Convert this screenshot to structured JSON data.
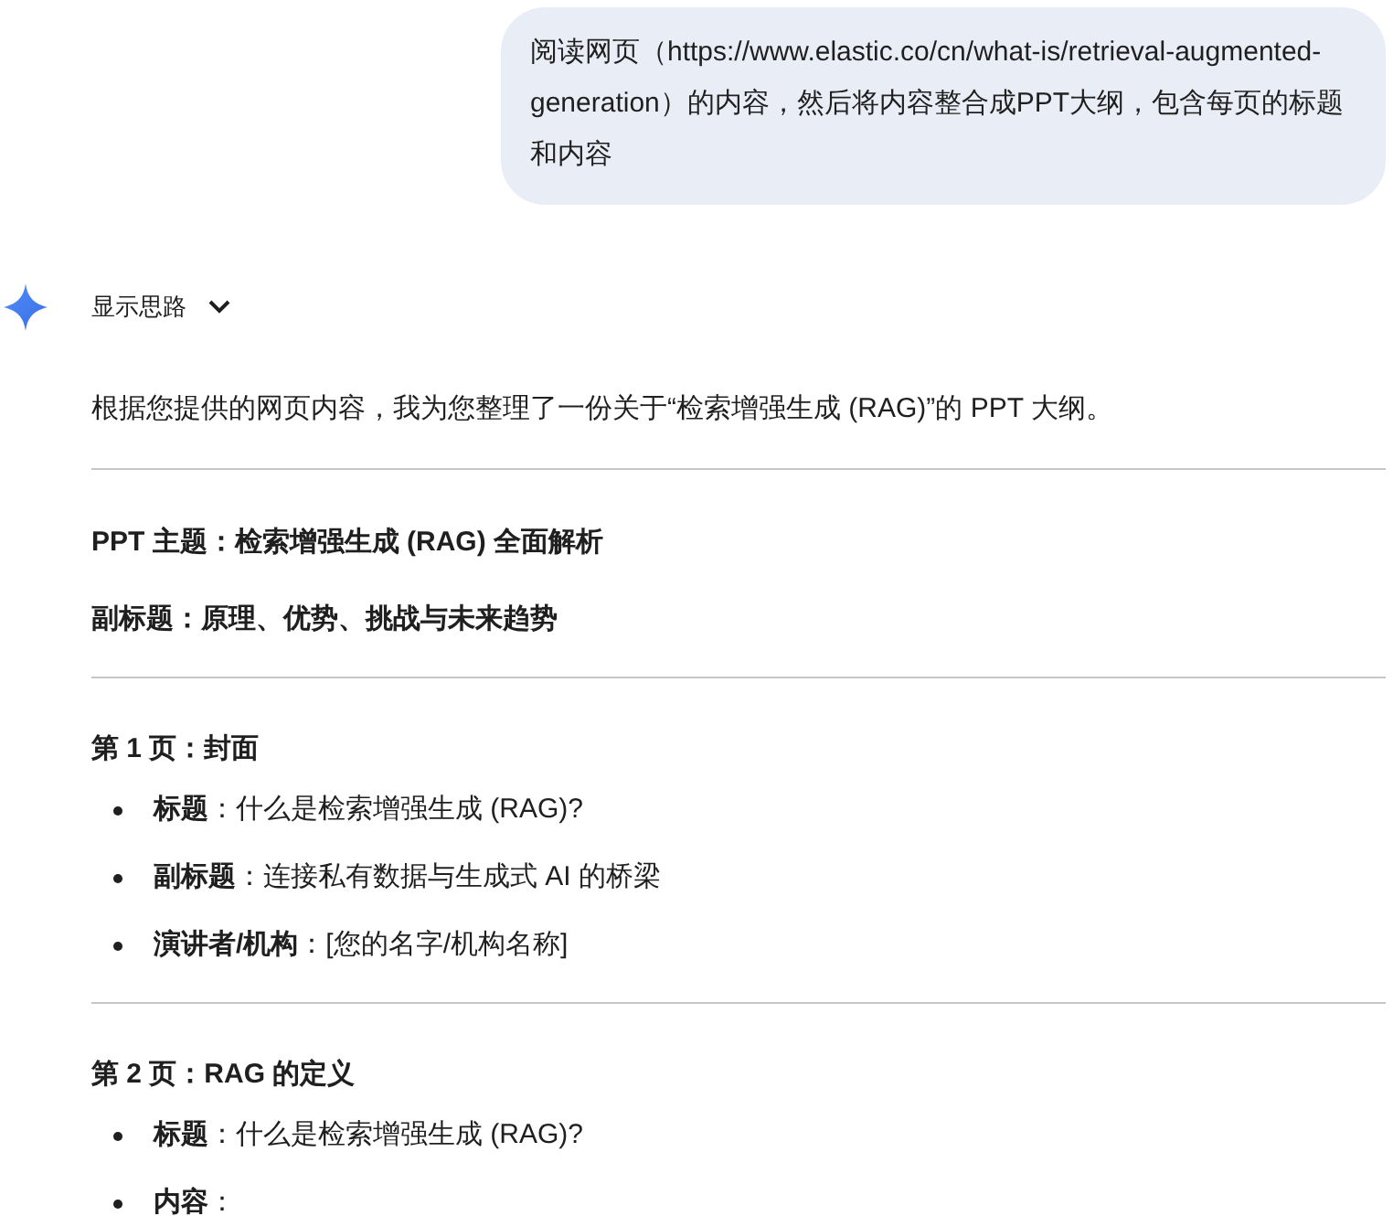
{
  "user_message": {
    "text": "阅读网页（https://www.elastic.co/cn/what-is/retrieval-augmented-generation）的内容，然后将内容整合成PPT大纲，包含每页的标题和内容"
  },
  "thinking_toggle": {
    "label": "显示思路",
    "expanded": false
  },
  "response": {
    "intro": "根据您提供的网页内容，我为您整理了一份关于“检索增强生成 (RAG)”的 PPT 大纲。",
    "overview": {
      "theme": "PPT 主题：检索增强生成 (RAG) 全面解析",
      "subtitle": "副标题：原理、优势、挑战与未来趋势"
    },
    "slides": [
      {
        "heading": "第 1 页：封面",
        "bullets": [
          "**标题**：什么是检索增强生成 (RAG)?",
          "**副标题**：连接私有数据与生成式 AI 的桥梁",
          "**演讲者/机构**：[您的名字/机构名称]"
        ]
      },
      {
        "heading": "第 2 页：RAG 的定义",
        "bullets": [
          "**标题**：什么是检索增强生成 (RAG)?",
          "**内容**："
        ]
      }
    ]
  }
}
